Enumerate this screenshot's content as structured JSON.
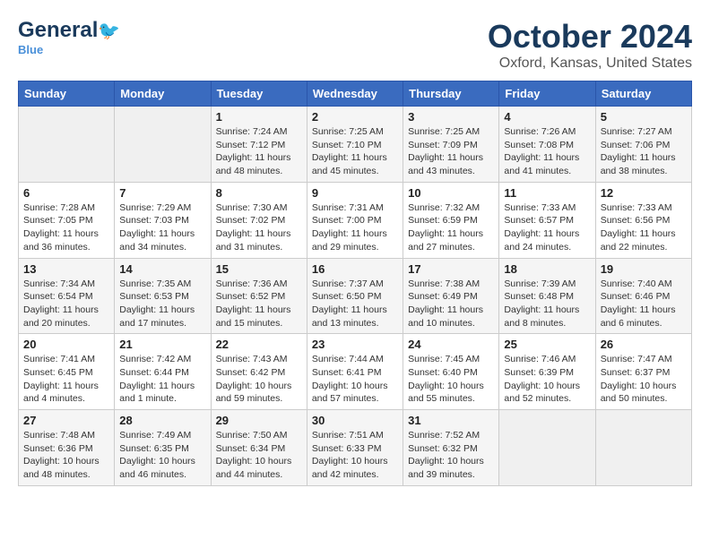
{
  "header": {
    "logo_general": "General",
    "logo_blue": "Blue",
    "title": "October 2024",
    "subtitle": "Oxford, Kansas, United States"
  },
  "days_of_week": [
    "Sunday",
    "Monday",
    "Tuesday",
    "Wednesday",
    "Thursday",
    "Friday",
    "Saturday"
  ],
  "weeks": [
    {
      "days": [
        {
          "num": "",
          "info": ""
        },
        {
          "num": "",
          "info": ""
        },
        {
          "num": "1",
          "info": "Sunrise: 7:24 AM\nSunset: 7:12 PM\nDaylight: 11 hours and 48 minutes."
        },
        {
          "num": "2",
          "info": "Sunrise: 7:25 AM\nSunset: 7:10 PM\nDaylight: 11 hours and 45 minutes."
        },
        {
          "num": "3",
          "info": "Sunrise: 7:25 AM\nSunset: 7:09 PM\nDaylight: 11 hours and 43 minutes."
        },
        {
          "num": "4",
          "info": "Sunrise: 7:26 AM\nSunset: 7:08 PM\nDaylight: 11 hours and 41 minutes."
        },
        {
          "num": "5",
          "info": "Sunrise: 7:27 AM\nSunset: 7:06 PM\nDaylight: 11 hours and 38 minutes."
        }
      ]
    },
    {
      "days": [
        {
          "num": "6",
          "info": "Sunrise: 7:28 AM\nSunset: 7:05 PM\nDaylight: 11 hours and 36 minutes."
        },
        {
          "num": "7",
          "info": "Sunrise: 7:29 AM\nSunset: 7:03 PM\nDaylight: 11 hours and 34 minutes."
        },
        {
          "num": "8",
          "info": "Sunrise: 7:30 AM\nSunset: 7:02 PM\nDaylight: 11 hours and 31 minutes."
        },
        {
          "num": "9",
          "info": "Sunrise: 7:31 AM\nSunset: 7:00 PM\nDaylight: 11 hours and 29 minutes."
        },
        {
          "num": "10",
          "info": "Sunrise: 7:32 AM\nSunset: 6:59 PM\nDaylight: 11 hours and 27 minutes."
        },
        {
          "num": "11",
          "info": "Sunrise: 7:33 AM\nSunset: 6:57 PM\nDaylight: 11 hours and 24 minutes."
        },
        {
          "num": "12",
          "info": "Sunrise: 7:33 AM\nSunset: 6:56 PM\nDaylight: 11 hours and 22 minutes."
        }
      ]
    },
    {
      "days": [
        {
          "num": "13",
          "info": "Sunrise: 7:34 AM\nSunset: 6:54 PM\nDaylight: 11 hours and 20 minutes."
        },
        {
          "num": "14",
          "info": "Sunrise: 7:35 AM\nSunset: 6:53 PM\nDaylight: 11 hours and 17 minutes."
        },
        {
          "num": "15",
          "info": "Sunrise: 7:36 AM\nSunset: 6:52 PM\nDaylight: 11 hours and 15 minutes."
        },
        {
          "num": "16",
          "info": "Sunrise: 7:37 AM\nSunset: 6:50 PM\nDaylight: 11 hours and 13 minutes."
        },
        {
          "num": "17",
          "info": "Sunrise: 7:38 AM\nSunset: 6:49 PM\nDaylight: 11 hours and 10 minutes."
        },
        {
          "num": "18",
          "info": "Sunrise: 7:39 AM\nSunset: 6:48 PM\nDaylight: 11 hours and 8 minutes."
        },
        {
          "num": "19",
          "info": "Sunrise: 7:40 AM\nSunset: 6:46 PM\nDaylight: 11 hours and 6 minutes."
        }
      ]
    },
    {
      "days": [
        {
          "num": "20",
          "info": "Sunrise: 7:41 AM\nSunset: 6:45 PM\nDaylight: 11 hours and 4 minutes."
        },
        {
          "num": "21",
          "info": "Sunrise: 7:42 AM\nSunset: 6:44 PM\nDaylight: 11 hours and 1 minute."
        },
        {
          "num": "22",
          "info": "Sunrise: 7:43 AM\nSunset: 6:42 PM\nDaylight: 10 hours and 59 minutes."
        },
        {
          "num": "23",
          "info": "Sunrise: 7:44 AM\nSunset: 6:41 PM\nDaylight: 10 hours and 57 minutes."
        },
        {
          "num": "24",
          "info": "Sunrise: 7:45 AM\nSunset: 6:40 PM\nDaylight: 10 hours and 55 minutes."
        },
        {
          "num": "25",
          "info": "Sunrise: 7:46 AM\nSunset: 6:39 PM\nDaylight: 10 hours and 52 minutes."
        },
        {
          "num": "26",
          "info": "Sunrise: 7:47 AM\nSunset: 6:37 PM\nDaylight: 10 hours and 50 minutes."
        }
      ]
    },
    {
      "days": [
        {
          "num": "27",
          "info": "Sunrise: 7:48 AM\nSunset: 6:36 PM\nDaylight: 10 hours and 48 minutes."
        },
        {
          "num": "28",
          "info": "Sunrise: 7:49 AM\nSunset: 6:35 PM\nDaylight: 10 hours and 46 minutes."
        },
        {
          "num": "29",
          "info": "Sunrise: 7:50 AM\nSunset: 6:34 PM\nDaylight: 10 hours and 44 minutes."
        },
        {
          "num": "30",
          "info": "Sunrise: 7:51 AM\nSunset: 6:33 PM\nDaylight: 10 hours and 42 minutes."
        },
        {
          "num": "31",
          "info": "Sunrise: 7:52 AM\nSunset: 6:32 PM\nDaylight: 10 hours and 39 minutes."
        },
        {
          "num": "",
          "info": ""
        },
        {
          "num": "",
          "info": ""
        }
      ]
    }
  ]
}
